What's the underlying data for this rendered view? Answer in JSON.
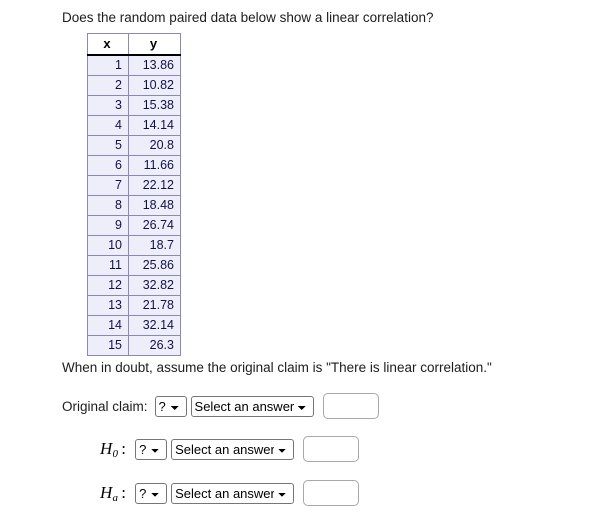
{
  "question": {
    "prompt": "Does the random paired data below show a linear correlation?",
    "note": "When in doubt, assume the original claim is \"There is linear correlation.\""
  },
  "table": {
    "headers": [
      "x",
      "y"
    ],
    "rows": [
      [
        "1",
        "13.86"
      ],
      [
        "2",
        "10.82"
      ],
      [
        "3",
        "15.38"
      ],
      [
        "4",
        "14.14"
      ],
      [
        "5",
        "20.8"
      ],
      [
        "6",
        "11.66"
      ],
      [
        "7",
        "22.12"
      ],
      [
        "8",
        "18.48"
      ],
      [
        "9",
        "26.74"
      ],
      [
        "10",
        "18.7"
      ],
      [
        "11",
        "25.86"
      ],
      [
        "12",
        "32.82"
      ],
      [
        "13",
        "21.78"
      ],
      [
        "14",
        "32.14"
      ],
      [
        "15",
        "26.3"
      ]
    ]
  },
  "chart_data": {
    "type": "table",
    "title": "Random paired data",
    "xlabel": "x",
    "ylabel": "y",
    "x": [
      1,
      2,
      3,
      4,
      5,
      6,
      7,
      8,
      9,
      10,
      11,
      12,
      13,
      14,
      15
    ],
    "y": [
      13.86,
      10.82,
      15.38,
      14.14,
      20.8,
      11.66,
      22.12,
      18.48,
      26.74,
      18.7,
      25.86,
      32.82,
      21.78,
      32.14,
      26.3
    ],
    "categories": [
      "1",
      "2",
      "3",
      "4",
      "5",
      "6",
      "7",
      "8",
      "9",
      "10",
      "11",
      "12",
      "13",
      "14",
      "15"
    ],
    "values": [
      13.86,
      10.82,
      15.38,
      14.14,
      20.8,
      11.66,
      22.12,
      18.48,
      26.74,
      18.7,
      25.86,
      32.82,
      21.78,
      32.14,
      26.3
    ]
  },
  "form": {
    "claim_label": "Original claim:",
    "h0_symbol": "H",
    "h0_sub": "0",
    "ha_symbol": "H",
    "ha_sub": "a",
    "colon": ":",
    "qmark_value": "?",
    "answer_value": "Select an answer",
    "value_input": "",
    "value_placeholder": ""
  }
}
